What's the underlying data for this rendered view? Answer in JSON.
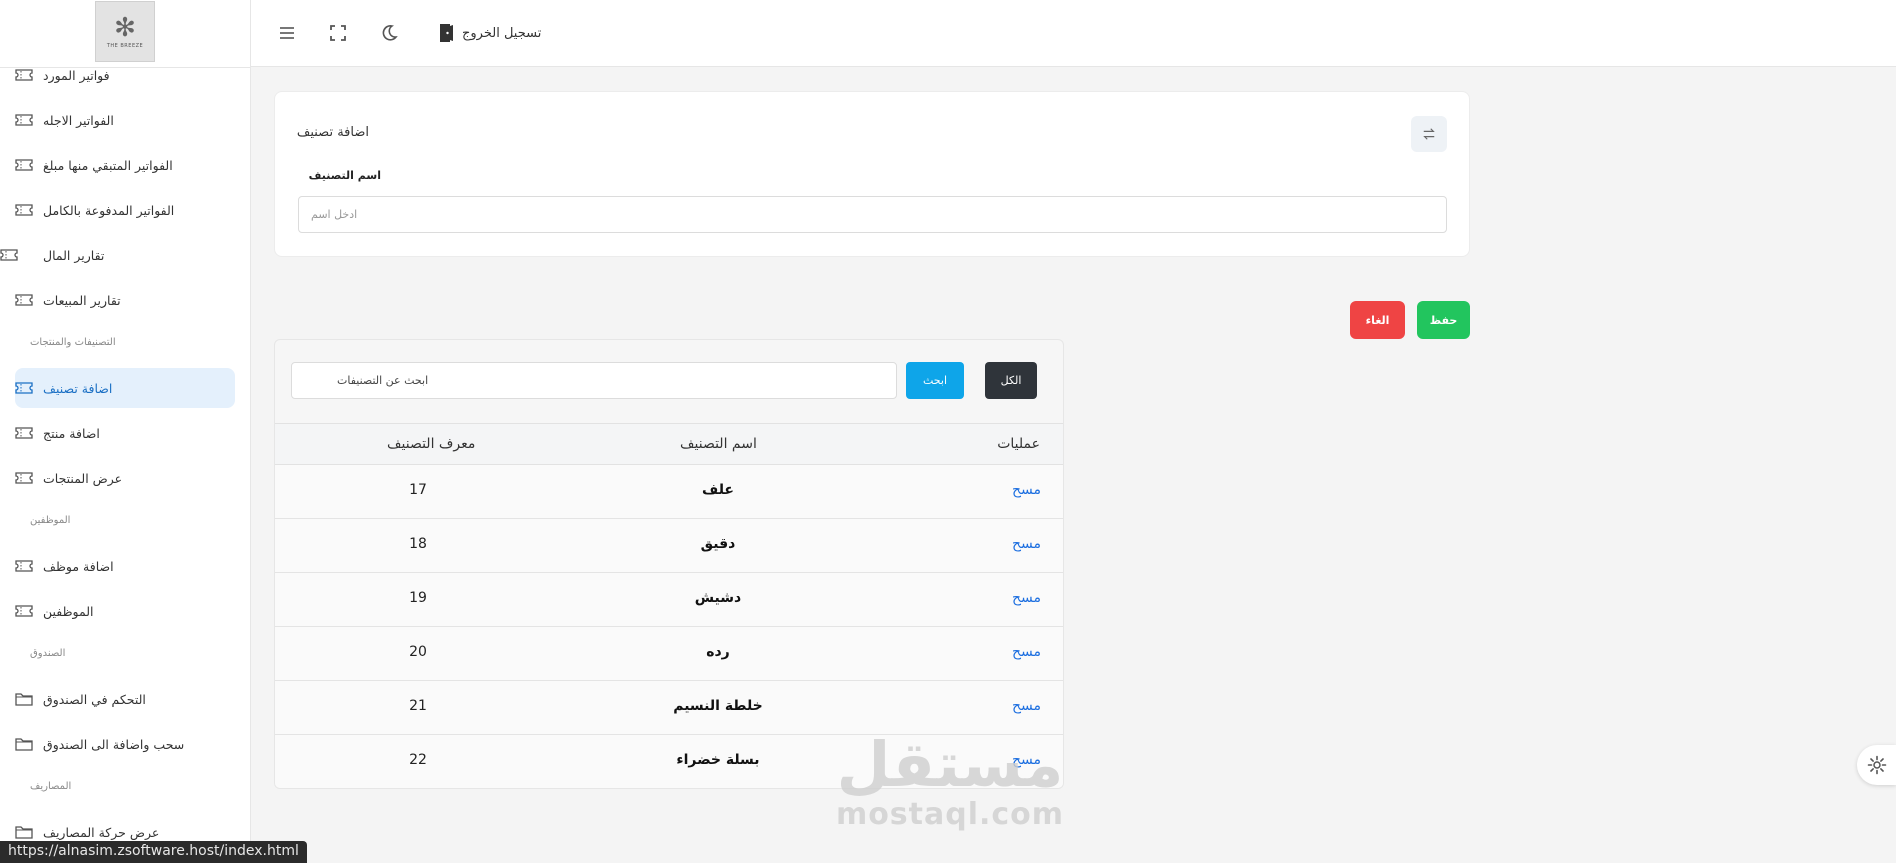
{
  "logo": {
    "text": "THE BREEZE"
  },
  "sidebar": {
    "items": [
      {
        "label": "فواتير المورد",
        "icon": "ticket-icon",
        "active": false
      },
      {
        "label": "الفواتير الاجله",
        "icon": "ticket-icon",
        "active": false
      },
      {
        "label": "الفواتير المتبقي منها مبلغ",
        "icon": "ticket-icon",
        "active": false
      },
      {
        "label": "الفواتير المدفوعة بالكامل",
        "icon": "ticket-icon",
        "active": false
      },
      {
        "label": "تقارير المال",
        "icon": "ticket-icon",
        "active": false
      },
      {
        "label": "تقارير المبيعات",
        "icon": "ticket-icon",
        "active": false
      },
      {
        "label": "اضافة تصنيف",
        "icon": "ticket-icon",
        "active": true
      },
      {
        "label": "اضافة منتج",
        "icon": "ticket-icon",
        "active": false
      },
      {
        "label": "عرض المنتجات",
        "icon": "ticket-icon",
        "active": false
      },
      {
        "label": "اضافة موظف",
        "icon": "ticket-icon",
        "active": false
      },
      {
        "label": "الموظفين",
        "icon": "ticket-icon",
        "active": false
      },
      {
        "label": "التحكم في الصندوق",
        "icon": "folder-icon",
        "active": false
      },
      {
        "label": "سحب واضافة الى الصندوق",
        "icon": "folder-icon",
        "active": false
      },
      {
        "label": "عرض حركة المصاريف",
        "icon": "folder-icon",
        "active": false
      }
    ],
    "sections": [
      {
        "label": "التصنيفات والمنتجات"
      },
      {
        "label": "الموظفين"
      },
      {
        "label": "الصندوق"
      },
      {
        "label": "المصاريف"
      }
    ]
  },
  "header": {
    "logout_label": "تسجيل الخروج",
    "icons": [
      "menu-icon",
      "fullscreen-icon",
      "moon-icon",
      "logout-door-icon"
    ]
  },
  "form": {
    "title": "اضافة تصنيف",
    "field_label": "اسم التصنيف",
    "placeholder": "ادخل اسم",
    "value": ""
  },
  "actions": {
    "save_label": "حفظ",
    "cancel_label": "الغاء",
    "save_color": "#22c55e",
    "cancel_color": "#ef4444"
  },
  "table": {
    "search_placeholder": "ابحث عن التصنيفات",
    "search_button": "ابحث",
    "all_button": "الكل",
    "headers": {
      "ops": "عمليات",
      "name": "اسم التصنيف",
      "id": "معرف التصنيف"
    },
    "rows": [
      {
        "op": "مسح",
        "name": "علف",
        "id": "17"
      },
      {
        "op": "مسح",
        "name": "دقيق",
        "id": "18"
      },
      {
        "op": "مسح",
        "name": "دشيش",
        "id": "19"
      },
      {
        "op": "مسح",
        "name": "رده",
        "id": "20"
      },
      {
        "op": "مسح",
        "name": "خلطة النسيم",
        "id": "21"
      },
      {
        "op": "مسح",
        "name": "بسلة خضراء",
        "id": "22"
      }
    ]
  },
  "watermark": {
    "arabic": "مستقل",
    "latin": "mostaql.com"
  },
  "status_bar": {
    "url": "https://alnasim.zsoftware.host/index.html"
  }
}
